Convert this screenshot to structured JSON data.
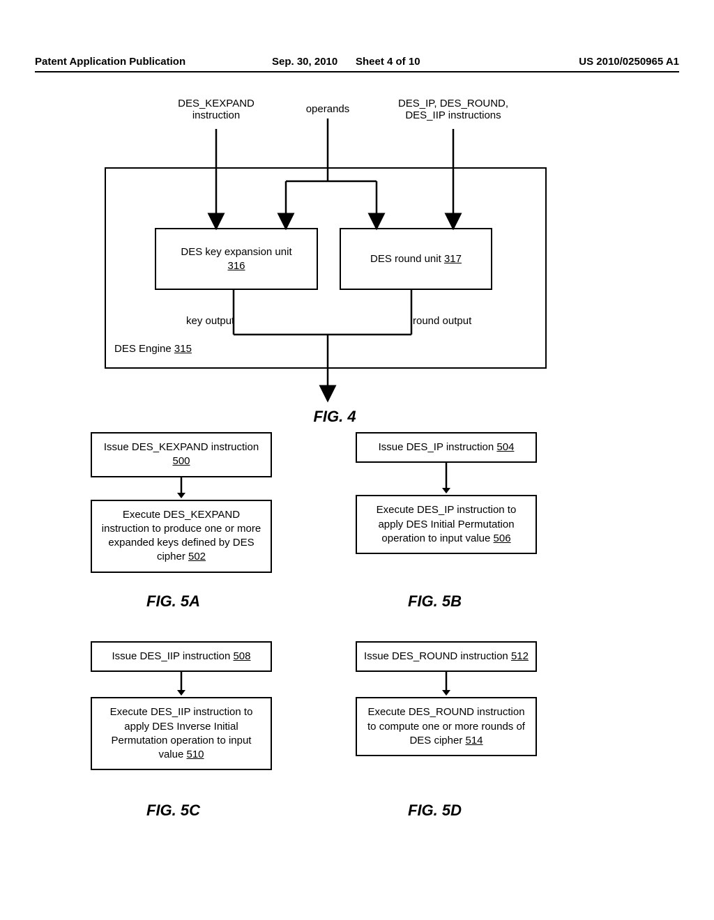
{
  "header": {
    "left": "Patent Application Publication",
    "date": "Sep. 30, 2010",
    "sheet": "Sheet 4 of 10",
    "pubno": "US 2010/0250965 A1"
  },
  "fig4": {
    "label_kexpand": "DES_KEXPAND instruction",
    "label_operands": "operands",
    "label_ipround": "DES_IP, DES_ROUND, DES_IIP instructions",
    "key_unit_text": "DES key expansion unit",
    "key_unit_ref": "316",
    "round_unit_text": "DES round unit ",
    "round_unit_ref": "317",
    "key_output": "key output",
    "round_output": "round output",
    "engine_text": "DES Engine ",
    "engine_ref": "315",
    "caption": "FIG. 4"
  },
  "fig5a": {
    "box1_text": "Issue DES_KEXPAND instruction ",
    "box1_ref": "500",
    "box2_text": "Execute DES_KEXPAND instruction to produce one or more expanded keys defined by DES cipher ",
    "box2_ref": "502",
    "caption": "FIG. 5A"
  },
  "fig5b": {
    "box1_text": "Issue DES_IP instruction ",
    "box1_ref": "504",
    "box2_text": "Execute DES_IP instruction to apply DES Initial Permutation operation to input value ",
    "box2_ref": "506",
    "caption": "FIG. 5B"
  },
  "fig5c": {
    "box1_text": "Issue DES_IIP instruction ",
    "box1_ref": "508",
    "box2_text": "Execute DES_IIP instruction to apply DES Inverse Initial Permutation operation to input value ",
    "box2_ref": "510",
    "caption": "FIG. 5C"
  },
  "fig5d": {
    "box1_text": "Issue DES_ROUND instruction ",
    "box1_ref": "512",
    "box2_text": "Execute DES_ROUND instruction to compute one or more rounds of DES cipher ",
    "box2_ref": "514",
    "caption": "FIG. 5D"
  }
}
